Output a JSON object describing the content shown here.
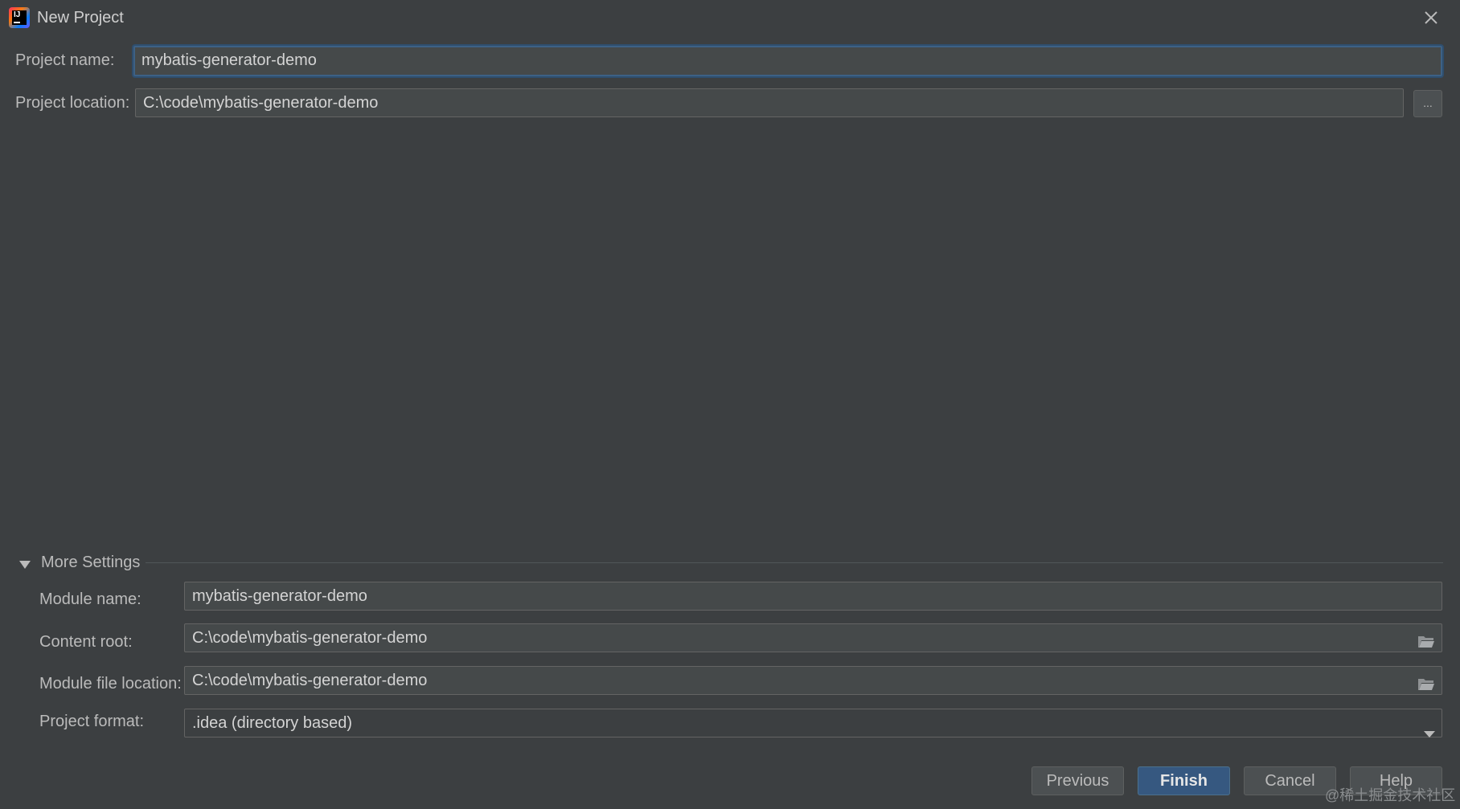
{
  "window": {
    "title": "New Project"
  },
  "project": {
    "name_label": "Project name:",
    "name_value": "mybatis-generator-demo",
    "location_label": "Project location:",
    "location_value": "C:\\code\\mybatis-generator-demo",
    "browse_label": "..."
  },
  "more_settings": {
    "title": "More Settings",
    "expanded": true,
    "module_name_label": "Module name:",
    "module_name_value": "mybatis-generator-demo",
    "content_root_label": "Content root:",
    "content_root_value": "C:\\code\\mybatis-generator-demo",
    "module_file_location_label": "Module file location:",
    "module_file_location_value": "C:\\code\\mybatis-generator-demo",
    "project_format_label": "Project format:",
    "project_format_value": ".idea (directory based)"
  },
  "buttons": {
    "previous": "Previous",
    "finish": "Finish",
    "cancel": "Cancel",
    "help": "Help"
  },
  "watermark": "@稀土掘金技术社区",
  "icons": {
    "app": "intellij-idea-icon",
    "close": "close-icon",
    "folder": "folder-icon",
    "collapse": "triangle-down-icon",
    "dropdown": "chevron-down-icon"
  },
  "colors": {
    "background": "#3c3f41",
    "input_background": "#45494a",
    "focus_border": "#3d6185",
    "primary_button": "#365880"
  }
}
